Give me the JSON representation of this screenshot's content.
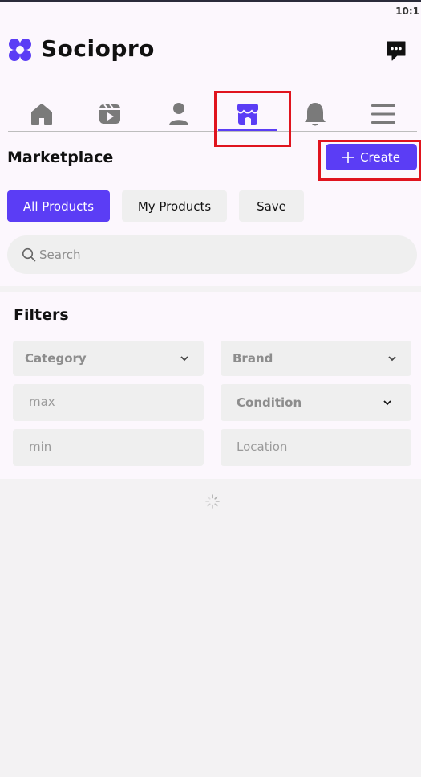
{
  "status_bar": {
    "time": "10:1"
  },
  "app": {
    "brand": "Sociopro"
  },
  "nav": {
    "items": [
      {
        "icon": "home-icon",
        "active": false
      },
      {
        "icon": "reels-icon",
        "active": false
      },
      {
        "icon": "profile-icon",
        "active": false
      },
      {
        "icon": "marketplace-icon",
        "active": true
      },
      {
        "icon": "bell-icon",
        "active": false
      },
      {
        "icon": "menu-icon",
        "active": false
      }
    ]
  },
  "page": {
    "title": "Marketplace",
    "create_label": "Create"
  },
  "tabs": [
    {
      "label": "All Products",
      "active": true
    },
    {
      "label": "My Products",
      "active": false
    },
    {
      "label": "Save",
      "active": false
    }
  ],
  "search": {
    "placeholder": "Search"
  },
  "filters": {
    "title": "Filters",
    "category_label": "Category",
    "brand_label": "Brand",
    "max_placeholder": "max",
    "condition_label": "Condition",
    "min_placeholder": "min",
    "location_placeholder": "Location"
  },
  "colors": {
    "accent": "#5b3df5",
    "highlight": "#e0141e",
    "icon_gray": "#7a7a7a",
    "header_bg": "#fcf7fd",
    "page_bg": "#f3f2f3"
  }
}
